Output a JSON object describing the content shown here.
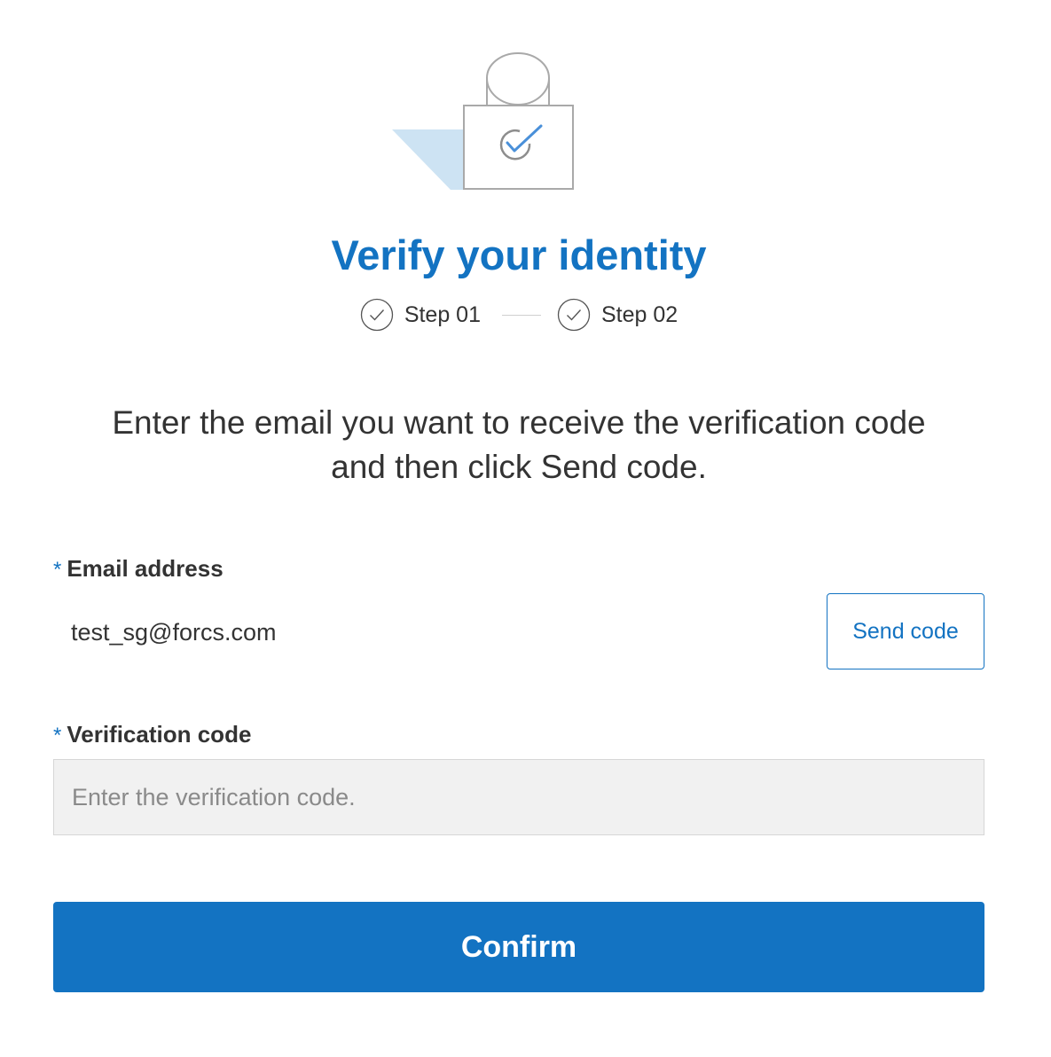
{
  "illustration": {
    "icon": "lock-check-icon",
    "accent_color": "#4a90d9",
    "shadow_color": "#cde3f3"
  },
  "header": {
    "title": "Verify your identity"
  },
  "steps": [
    {
      "label": "Step 01",
      "icon": "check-circle-icon"
    },
    {
      "label": "Step 02",
      "icon": "check-circle-icon"
    }
  ],
  "instruction": {
    "line1": "Enter the email you want to receive the verification code",
    "line2": "and then click Send code."
  },
  "email": {
    "required_mark": "*",
    "label": "Email address",
    "value": "test_sg@forcs.com",
    "send_button": "Send code"
  },
  "verification": {
    "required_mark": "*",
    "label": "Verification code",
    "placeholder": "Enter the verification code.",
    "value": ""
  },
  "confirm_button": "Confirm",
  "colors": {
    "primary": "#1373c2",
    "text": "#333333",
    "input_bg": "#f1f1f1"
  }
}
